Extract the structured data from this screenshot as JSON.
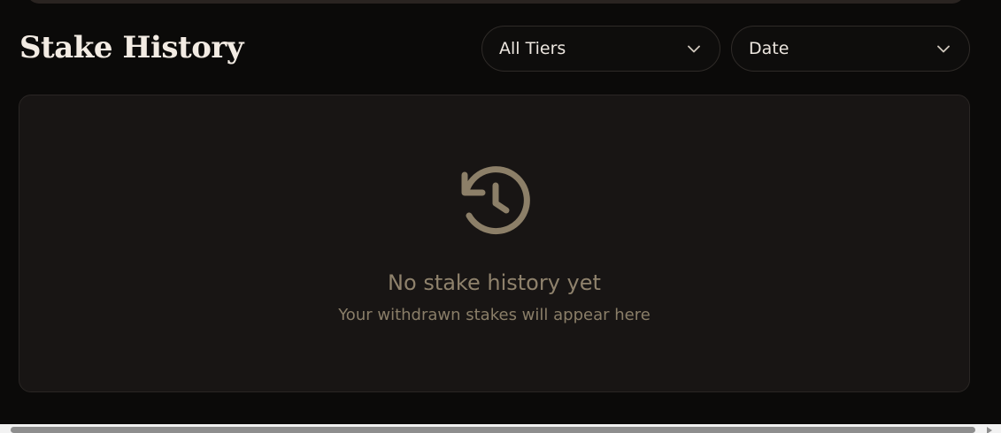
{
  "header": {
    "title": "Stake History"
  },
  "filters": {
    "tier": {
      "selected": "All Tiers",
      "icon": "chevron-down-icon"
    },
    "sort": {
      "selected": "Date",
      "icon": "chevron-down-icon"
    }
  },
  "empty_state": {
    "icon": "history-icon",
    "title": "No stake history yet",
    "subtitle": "Your withdrawn stakes will appear here"
  },
  "colors": {
    "background": "#0b0a09",
    "panel": "#181514",
    "title_text": "#f2ebe3",
    "muted_accent": "#8f826c"
  }
}
